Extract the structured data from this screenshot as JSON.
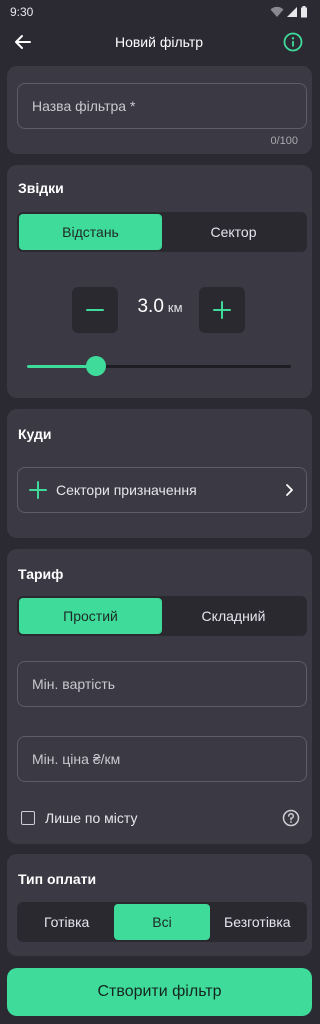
{
  "status_bar": {
    "time": "9:30"
  },
  "app_bar": {
    "title": "Новий фільтр"
  },
  "name_field": {
    "placeholder": "Назва фільтра *",
    "counter": "0/100"
  },
  "from_section": {
    "title": "Звідки",
    "segment": {
      "options": [
        "Відстань",
        "Сектор"
      ],
      "selected": "Відстань"
    },
    "distance": {
      "value": "3.0",
      "unit": "км",
      "slider_fraction": 0.26
    }
  },
  "to_section": {
    "title": "Куди",
    "destination_label": "Сектори призначення"
  },
  "tariff_section": {
    "title": "Тариф",
    "segment": {
      "options": [
        "Простий",
        "Складний"
      ],
      "selected": "Простий"
    },
    "min_cost_placeholder": "Мін. вартість",
    "min_price_placeholder": "Мін. ціна ₴/км",
    "city_only_label": "Лише по місту",
    "city_only_checked": false
  },
  "payment_section": {
    "title": "Тип оплати",
    "segment": {
      "options": [
        "Готівка",
        "Всі",
        "Безготівка"
      ],
      "selected": "Всі"
    }
  },
  "create_button_label": "Створити фільтр",
  "colors": {
    "accent": "#3fdb9a",
    "background": "#2b2a33",
    "card": "#3b3a44"
  }
}
